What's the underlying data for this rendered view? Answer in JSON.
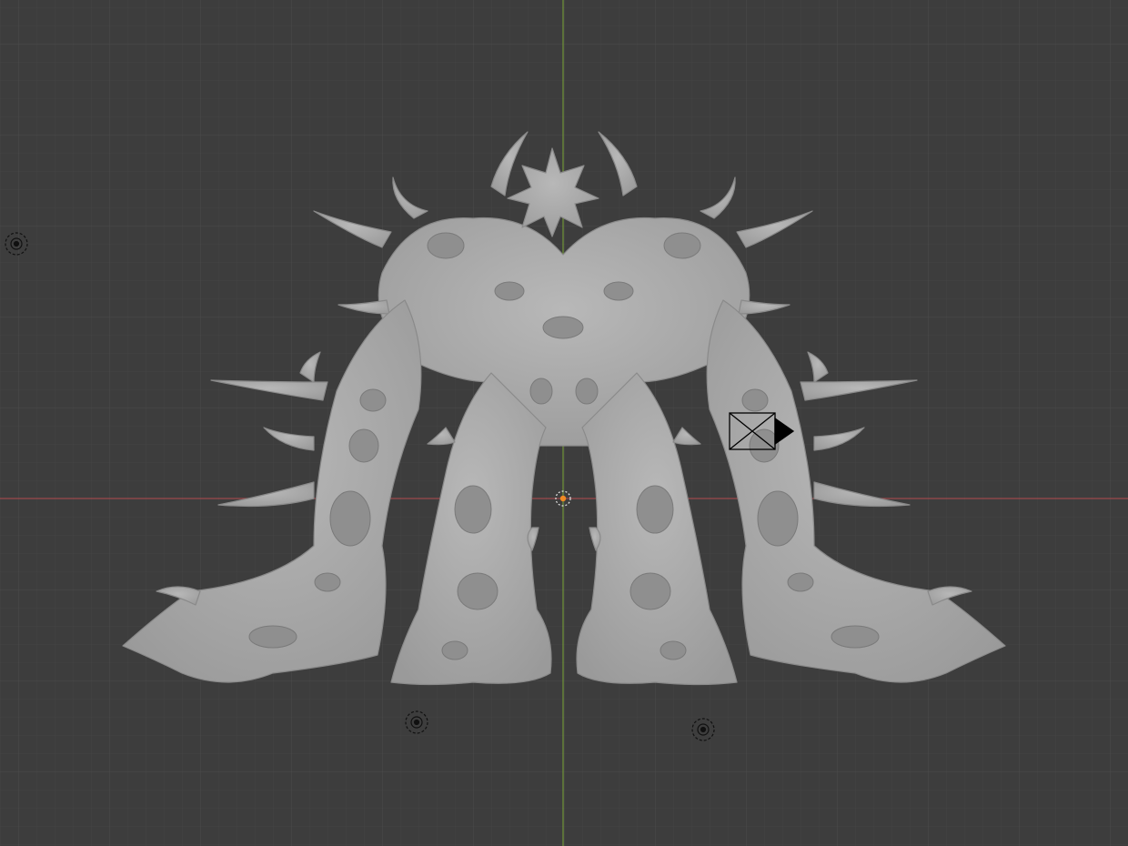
{
  "app": "Blender",
  "viewport": {
    "view": "front-orthographic",
    "shading": "solid",
    "colors": {
      "background": "#3d3d3d",
      "grid_minor": "#444444",
      "grid_major": "#4b4b4b",
      "axis_x": "#9c4a4d",
      "axis_z": "#6e8f3a",
      "mesh_fill": "#a9a9a9",
      "mesh_shadow": "#7d7d7d",
      "mesh_highlight": "#c4c4c4",
      "origin": "#f08a24"
    }
  },
  "scene_objects": [
    {
      "name": "sculpted-creature-mesh",
      "type": "mesh",
      "icon": "mesh-object"
    },
    {
      "name": "camera",
      "type": "camera",
      "icon": "camera-icon"
    },
    {
      "name": "light",
      "type": "point-light",
      "icon": "light-icon"
    },
    {
      "name": "light",
      "type": "point-light",
      "icon": "light-icon"
    },
    {
      "name": "light",
      "type": "point-light",
      "icon": "light-icon"
    }
  ]
}
